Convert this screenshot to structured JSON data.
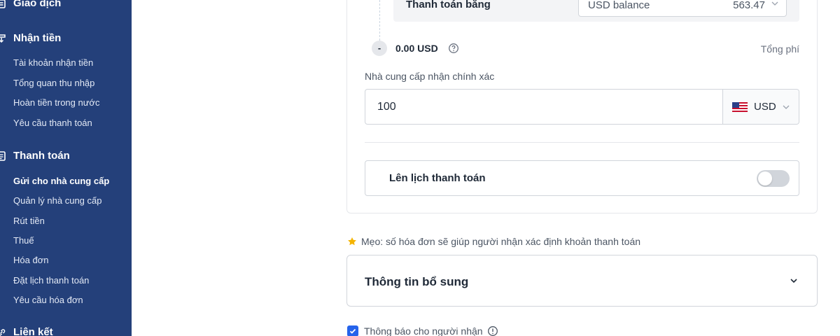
{
  "sidebar": {
    "sections": [
      {
        "label": "Giao dịch",
        "icon": "transaction-icon"
      },
      {
        "label": "Nhận tiền",
        "icon": "receive-money-icon"
      },
      {
        "label": "Thanh toán",
        "icon": "payment-icon"
      },
      {
        "label": "Liên kết",
        "icon": "link-icon"
      }
    ],
    "receive_items": [
      "Tài khoản nhận tiền",
      "Tổng quan thu nhập",
      "Hoàn tiền trong nước",
      "Yêu cầu thanh toán"
    ],
    "payment_items": [
      "Gửi cho nhà cung cấp",
      "Quản lý nhà cung cấp",
      "Rút tiền",
      "Thuế",
      "Hóa đơn",
      "Đặt lịch thanh toán",
      "Yêu cầu hóa đơn"
    ],
    "active_item": "Gửi cho nhà cung cấp"
  },
  "payment": {
    "pay_with_label": "Thanh toán bằng",
    "source_label": "USD balance",
    "source_balance": "563.47",
    "fee_sign": "-",
    "fee_amount": "0.00 USD",
    "fee_label": "Tổng phí"
  },
  "amount": {
    "label": "Nhà cung cấp nhận chính xác",
    "value": "100",
    "currency": "USD"
  },
  "schedule": {
    "label": "Lên lịch thanh toán",
    "enabled": false
  },
  "tip": "Mẹo: số hóa đơn sẽ giúp người nhận xác định khoản thanh toán",
  "additional_info": {
    "title": "Thông tin bổ sung"
  },
  "notify": {
    "label": "Thông báo cho người nhận",
    "checked": true
  },
  "colors": {
    "sidebar_bg": "#24407a",
    "accent": "#2563eb",
    "star": "#f5b400"
  }
}
